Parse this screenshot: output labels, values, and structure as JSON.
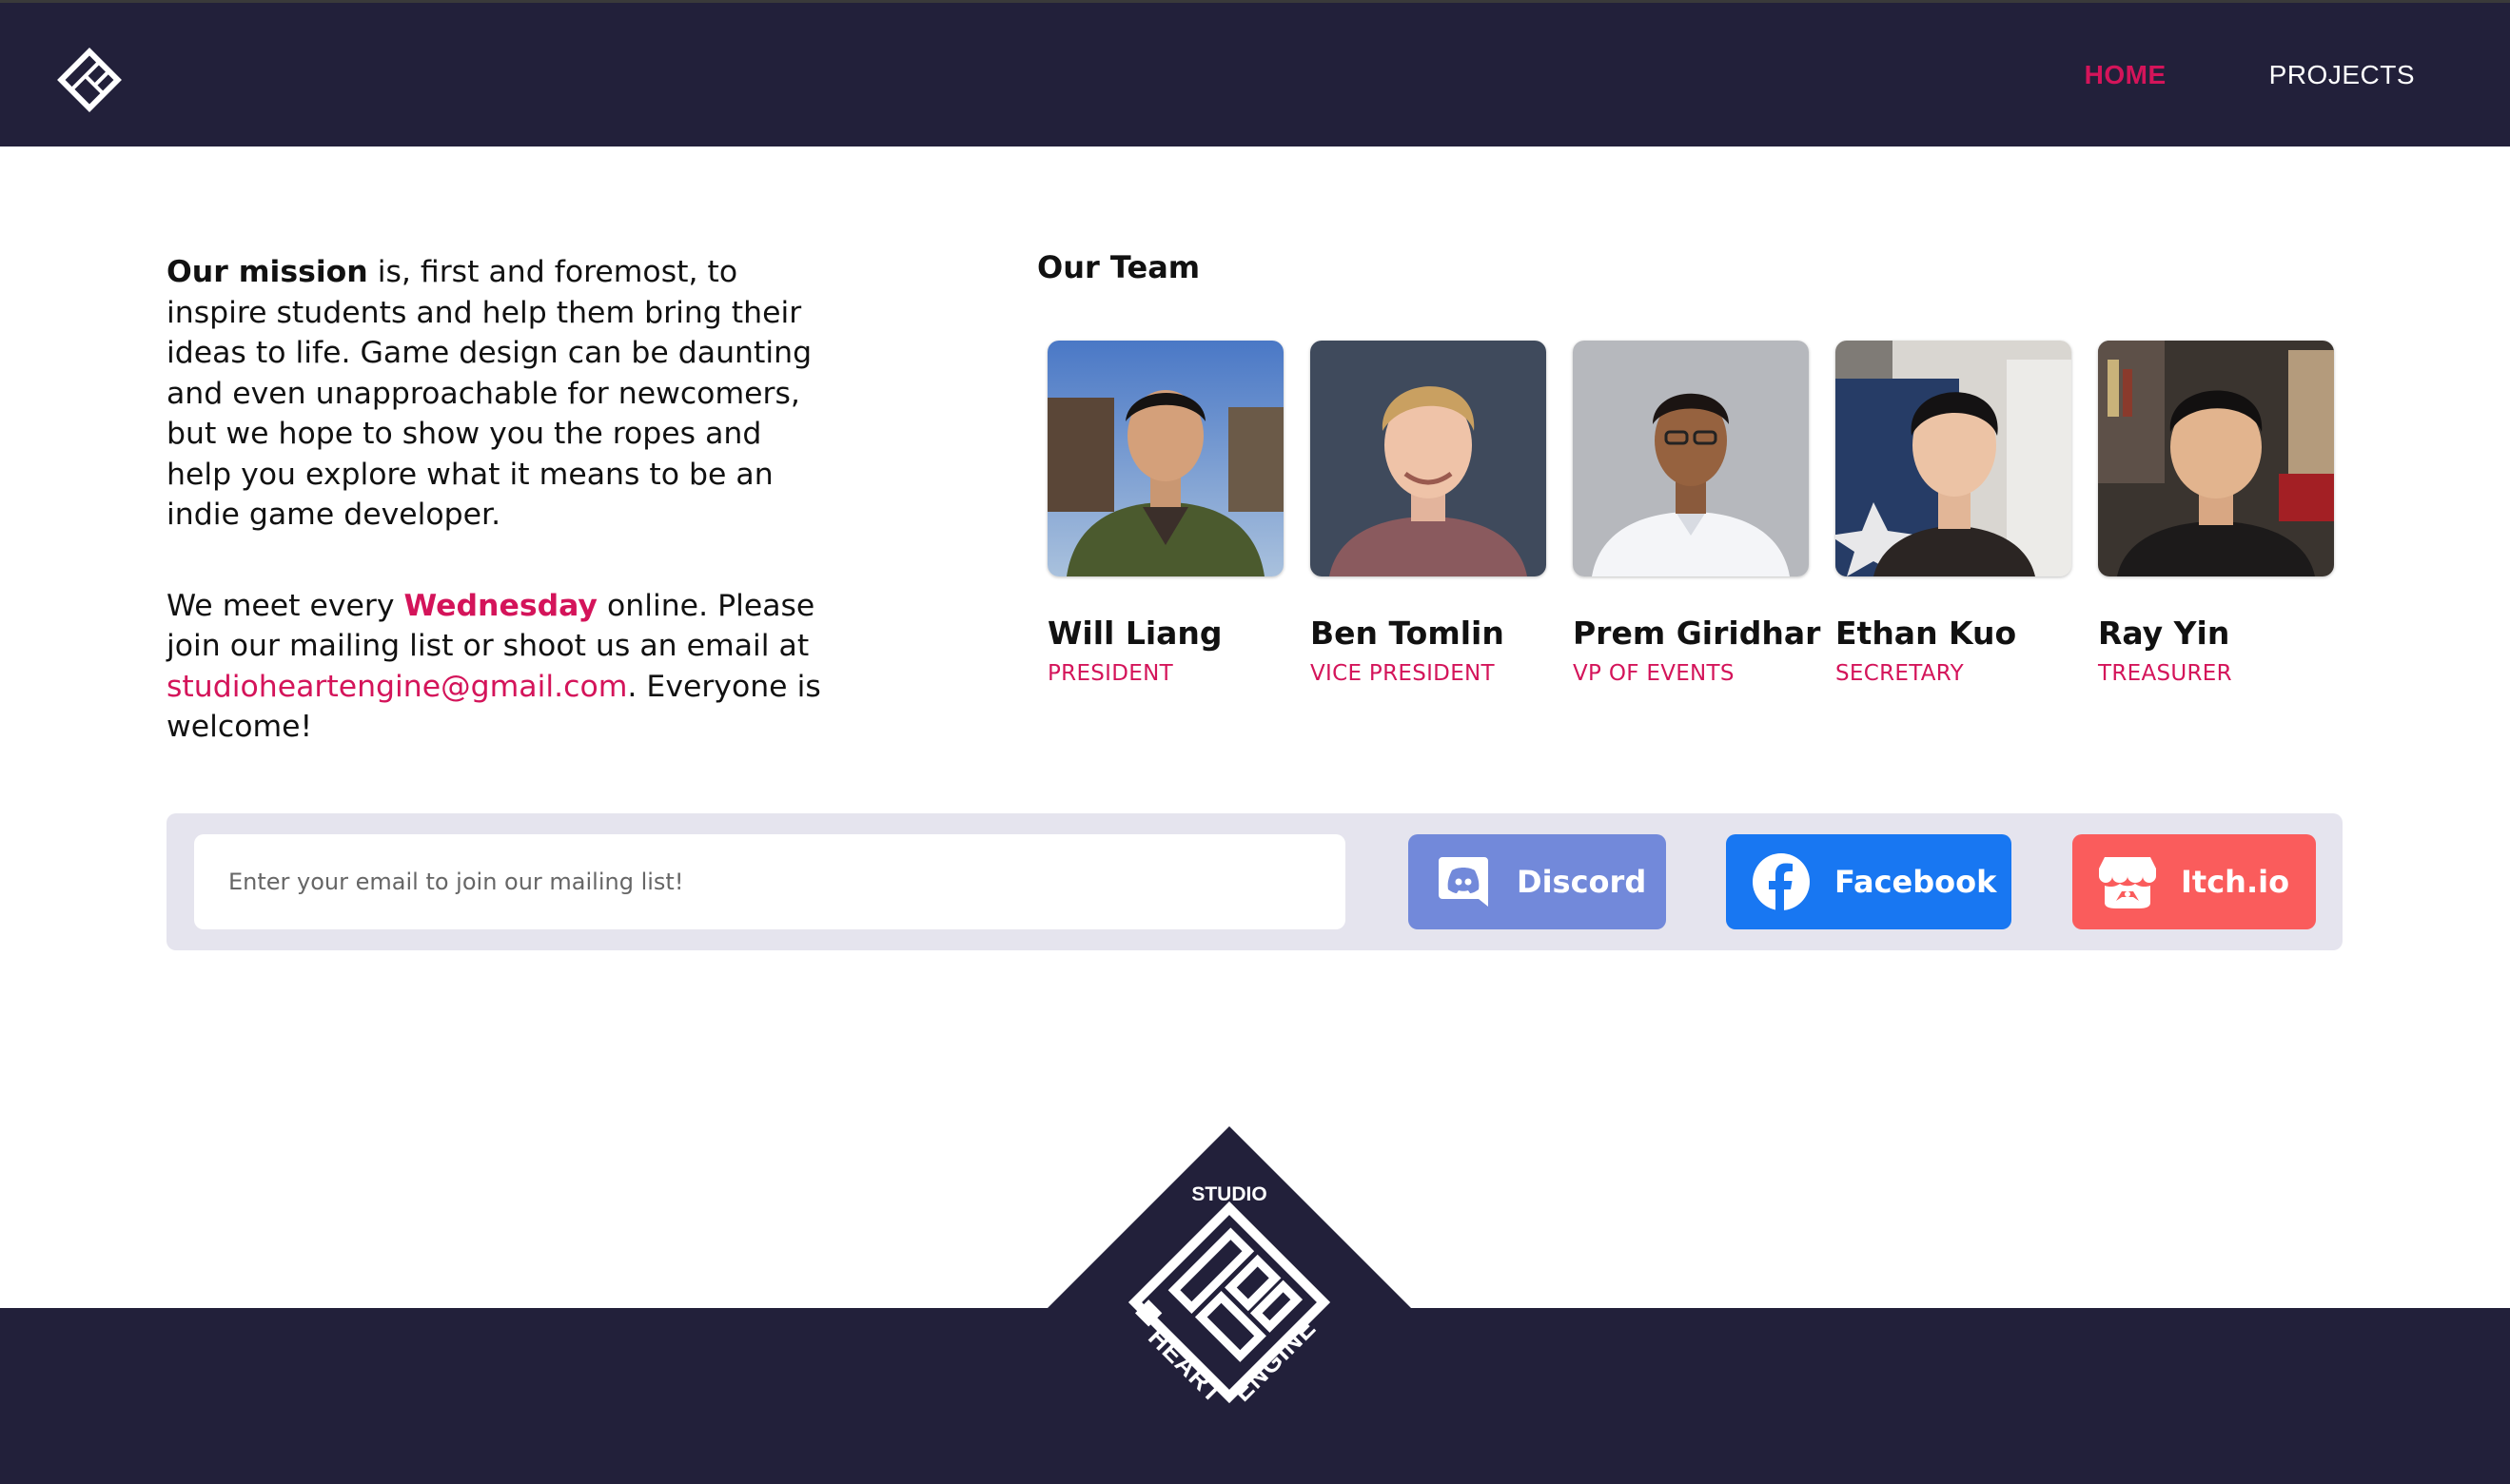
{
  "nav": {
    "home": "HOME",
    "projects": "PROJECTS"
  },
  "mission": {
    "lead": "Our mission",
    "body": " is, first and foremost, to inspire students and help them bring their ideas to life. Game design can be daunting and even unapproachable for newcomers, but we hope to show you the ropes and help you explore what it means to be an indie game developer.",
    "meet_prefix": "We meet every ",
    "meet_day": "Wednesday",
    "meet_mid": " online. Please join our mailing list or shoot us an email at ",
    "email": "studioheartengine@gmail.com",
    "meet_suffix": ". Everyone is welcome!"
  },
  "team": {
    "title": "Our Team",
    "members": [
      {
        "name": "Will Liang",
        "role": "PRESIDENT"
      },
      {
        "name": "Ben Tomlin",
        "role": "VICE PRESIDENT"
      },
      {
        "name": "Prem Giridhar",
        "role": "VP OF EVENTS"
      },
      {
        "name": "Ethan Kuo",
        "role": "SECRETARY"
      },
      {
        "name": "Ray Yin",
        "role": "TREASURER"
      }
    ]
  },
  "mailing": {
    "placeholder": "Enter your email to join our mailing list!",
    "discord": "Discord",
    "facebook": "Facebook",
    "itch": "Itch.io"
  },
  "footer_logo": {
    "studio": "STUDIO",
    "heart": "HEART",
    "engine": "ENGINE"
  },
  "colors": {
    "navy": "#22203a",
    "accent": "#d4145a",
    "discord": "#7289da",
    "facebook": "#1877f2",
    "itch": "#fa5c5c",
    "bar": "#e5e4ee"
  }
}
